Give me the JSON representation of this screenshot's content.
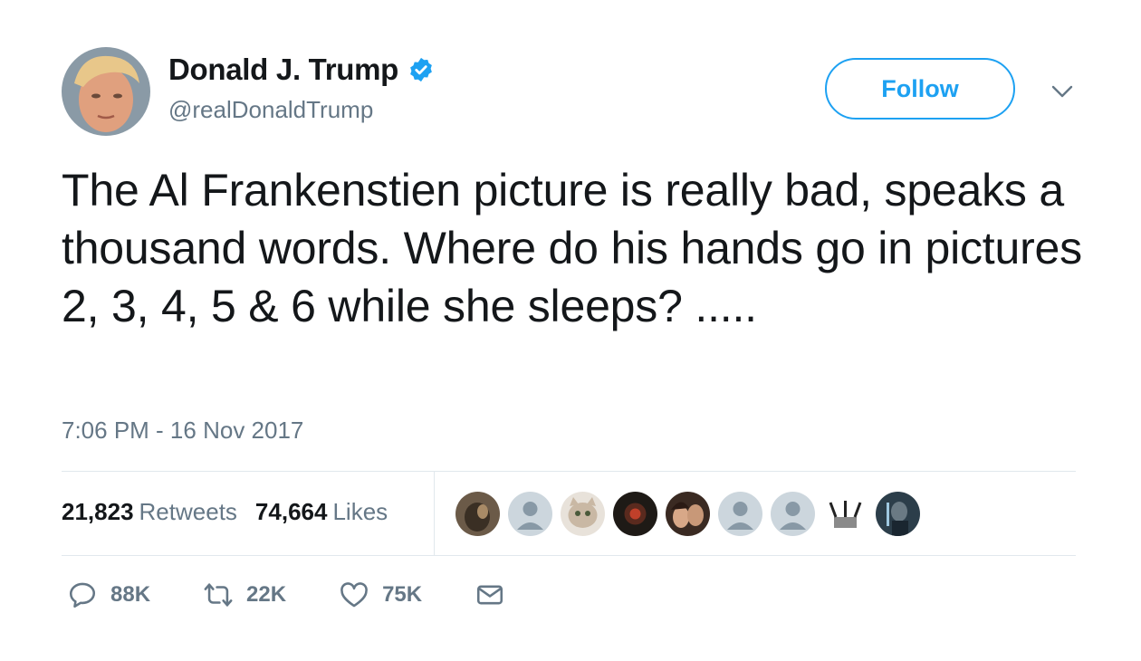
{
  "user": {
    "display_name": "Donald J. Trump",
    "handle": "@realDonaldTrump",
    "verified": true
  },
  "follow_button": {
    "label": "Follow"
  },
  "tweet": {
    "text": "The Al Frankenstien picture is really bad, speaks a thousand words. Where do his hands go in pictures 2, 3, 4, 5 & 6 while she sleeps? .....",
    "timestamp": "7:06 PM - 16 Nov 2017"
  },
  "stats": {
    "retweets_count": "21,823",
    "retweets_label": "Retweets",
    "likes_count": "74,664",
    "likes_label": "Likes"
  },
  "likers_count": 9,
  "actions": {
    "reply_count": "88K",
    "retweet_count": "22K",
    "like_count": "75K"
  },
  "colors": {
    "accent": "#1da1f2",
    "text": "#14171a",
    "secondary": "#657786",
    "divider": "#e1e8ed"
  },
  "icons": [
    "verified-badge-icon",
    "chevron-down-icon",
    "reply-icon",
    "retweet-icon",
    "heart-icon",
    "envelope-icon"
  ]
}
